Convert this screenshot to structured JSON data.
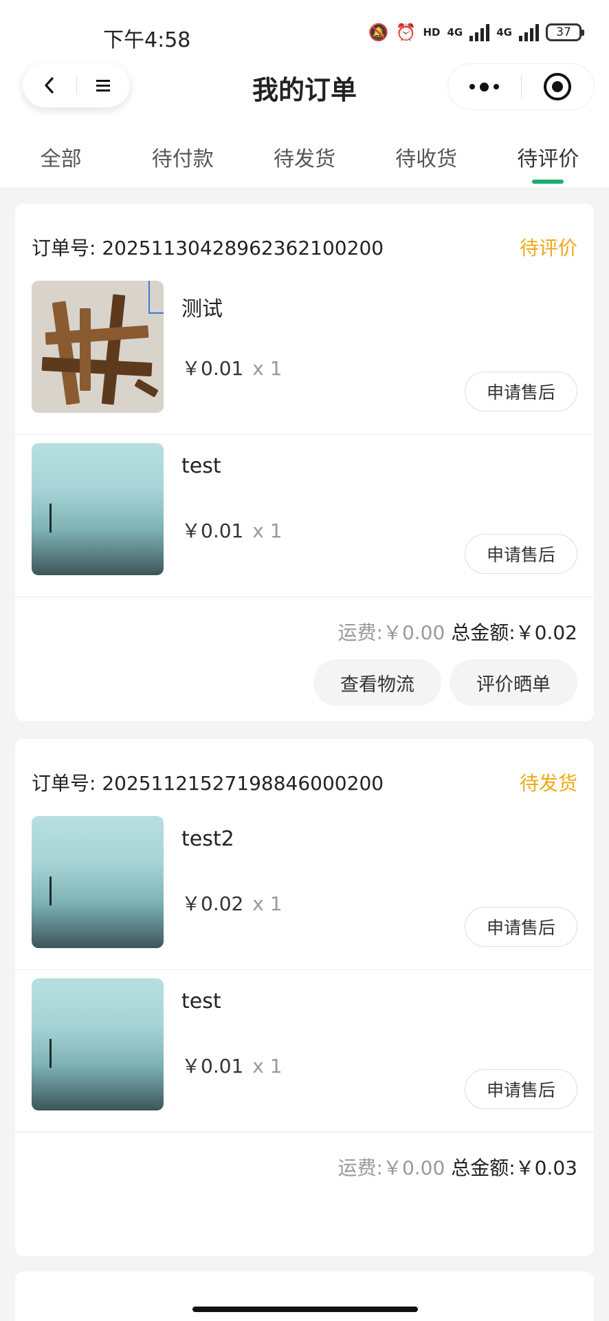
{
  "status_bar": {
    "time": "下午4:58",
    "network_1": "4G",
    "network_2": "4G",
    "hd": "HD",
    "battery": "37"
  },
  "nav": {
    "title": "我的订单",
    "back_icon": "chevron-left-icon",
    "menu_icon": "menu-lines-icon",
    "more_icon": "more-dots-icon",
    "close_icon": "target-circle-icon"
  },
  "tabs": [
    {
      "label": "全部",
      "active": false
    },
    {
      "label": "待付款",
      "active": false
    },
    {
      "label": "待发货",
      "active": false
    },
    {
      "label": "待收货",
      "active": false
    },
    {
      "label": "待评价",
      "active": true
    }
  ],
  "colors": {
    "accent_green": "#1aad6e",
    "status_orange": "#f0a814"
  },
  "orders": [
    {
      "order_no": "订单号: 20251130428962362100200",
      "status": "待评价",
      "items": [
        {
          "name": "测试",
          "price": "￥0.01",
          "qty": "x 1",
          "button": "申请售后",
          "image": "wood-planks-photo"
        },
        {
          "name": "test",
          "price": "￥0.01",
          "qty": "x 1",
          "button": "申请售后",
          "image": "sea-figure-photo"
        }
      ],
      "fee_label": "运费:",
      "fee_value": "￥0.00",
      "total_label": "总金额:",
      "total_value": "￥0.02",
      "actions": [
        "查看物流",
        "评价晒单"
      ]
    },
    {
      "order_no": "订单号: 20251121527198846000200",
      "status": "待发货",
      "items": [
        {
          "name": "test2",
          "price": "￥0.02",
          "qty": "x 1",
          "button": "申请售后",
          "image": "sea-figure-photo"
        },
        {
          "name": "test",
          "price": "￥0.01",
          "qty": "x 1",
          "button": "申请售后",
          "image": "sea-figure-photo"
        }
      ],
      "fee_label": "运费:",
      "fee_value": "￥0.00",
      "total_label": "总金额:",
      "total_value": "￥0.03",
      "actions": []
    }
  ]
}
